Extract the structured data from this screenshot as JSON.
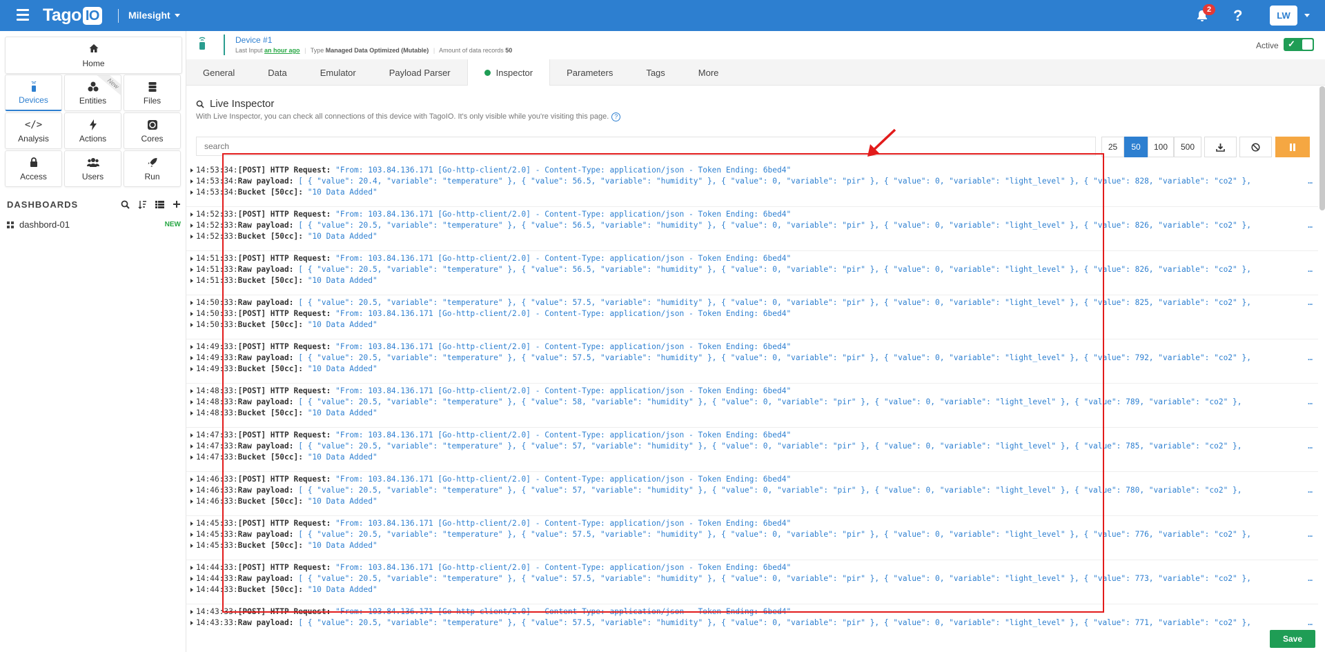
{
  "topbar": {
    "logo": "Tago",
    "logo_io": "IO",
    "account": "Milesight",
    "notifications": "2",
    "help": "?",
    "user": "LW"
  },
  "sidebar": {
    "home": "Home",
    "tiles": [
      "Devices",
      "Entities",
      "Files",
      "Analysis",
      "Actions",
      "Cores",
      "Access",
      "Users",
      "Run"
    ],
    "entities_ribbon": "New",
    "dashboards_title": "DASHBOARDS",
    "dashboards": [
      {
        "name": "dashbord-01",
        "badge": "NEW"
      }
    ]
  },
  "device": {
    "name": "Device #1",
    "last_input_label": "Last Input",
    "last_input": "an hour ago",
    "type_label": "Type",
    "type": "Managed Data Optimized (Mutable)",
    "records_label": "Amount of data records",
    "records": "50",
    "active_label": "Active"
  },
  "tabs": [
    "General",
    "Data",
    "Emulator",
    "Payload Parser",
    "Inspector",
    "Parameters",
    "Tags",
    "More"
  ],
  "inspector": {
    "title": "Live Inspector",
    "description": "With Live Inspector, you can check all connections of this device with TagoIO. It's only visible while you're visiting this page.",
    "search_placeholder": "search",
    "page_sizes": [
      "25",
      "50",
      "100",
      "500"
    ]
  },
  "log_entries": [
    [
      "14:53:34",
      "[POST] HTTP Request:",
      "\"From: 103.84.136.171 [Go-http-client/2.0] - Content-Type: application/json - Token Ending: 6bed4\""
    ],
    [
      "14:53:34",
      "Raw payload:",
      "[ { \"value\": 20.4, \"variable\": \"temperature\" }, { \"value\": 56.5, \"variable\": \"humidity\" }, { \"value\": 0, \"variable\": \"pir\" }, { \"value\": 0, \"variable\": \"light_level\" }, { \"value\": 828, \"variable\": \"co2\" },"
    ],
    [
      "14:53:34",
      "Bucket [50cc]:",
      "\"10 Data Added\""
    ],
    [
      "14:52:33",
      "[POST] HTTP Request:",
      "\"From: 103.84.136.171 [Go-http-client/2.0] - Content-Type: application/json - Token Ending: 6bed4\""
    ],
    [
      "14:52:33",
      "Raw payload:",
      "[ { \"value\": 20.5, \"variable\": \"temperature\" }, { \"value\": 56.5, \"variable\": \"humidity\" }, { \"value\": 0, \"variable\": \"pir\" }, { \"value\": 0, \"variable\": \"light_level\" }, { \"value\": 826, \"variable\": \"co2\" },"
    ],
    [
      "14:52:33",
      "Bucket [50cc]:",
      "\"10 Data Added\""
    ],
    [
      "14:51:33",
      "[POST] HTTP Request:",
      "\"From: 103.84.136.171 [Go-http-client/2.0] - Content-Type: application/json - Token Ending: 6bed4\""
    ],
    [
      "14:51:33",
      "Raw payload:",
      "[ { \"value\": 20.5, \"variable\": \"temperature\" }, { \"value\": 56.5, \"variable\": \"humidity\" }, { \"value\": 0, \"variable\": \"pir\" }, { \"value\": 0, \"variable\": \"light_level\" }, { \"value\": 826, \"variable\": \"co2\" },"
    ],
    [
      "14:51:33",
      "Bucket [50cc]:",
      "\"10 Data Added\""
    ],
    [
      "14:50:33",
      "Raw payload:",
      "[ { \"value\": 20.5, \"variable\": \"temperature\" }, { \"value\": 57.5, \"variable\": \"humidity\" }, { \"value\": 0, \"variable\": \"pir\" }, { \"value\": 0, \"variable\": \"light_level\" }, { \"value\": 825, \"variable\": \"co2\" },"
    ],
    [
      "14:50:33",
      "[POST] HTTP Request:",
      "\"From: 103.84.136.171 [Go-http-client/2.0] - Content-Type: application/json - Token Ending: 6bed4\""
    ],
    [
      "14:50:33",
      "Bucket [50cc]:",
      "\"10 Data Added\""
    ],
    [
      "14:49:33",
      "[POST] HTTP Request:",
      "\"From: 103.84.136.171 [Go-http-client/2.0] - Content-Type: application/json - Token Ending: 6bed4\""
    ],
    [
      "14:49:33",
      "Raw payload:",
      "[ { \"value\": 20.5, \"variable\": \"temperature\" }, { \"value\": 57.5, \"variable\": \"humidity\" }, { \"value\": 0, \"variable\": \"pir\" }, { \"value\": 0, \"variable\": \"light_level\" }, { \"value\": 792, \"variable\": \"co2\" },"
    ],
    [
      "14:49:33",
      "Bucket [50cc]:",
      "\"10 Data Added\""
    ],
    [
      "14:48:33",
      "[POST] HTTP Request:",
      "\"From: 103.84.136.171 [Go-http-client/2.0] - Content-Type: application/json - Token Ending: 6bed4\""
    ],
    [
      "14:48:33",
      "Raw payload:",
      "[ { \"value\": 20.5, \"variable\": \"temperature\" }, { \"value\": 58, \"variable\": \"humidity\" }, { \"value\": 0, \"variable\": \"pir\" }, { \"value\": 0, \"variable\": \"light_level\" }, { \"value\": 789, \"variable\": \"co2\" },"
    ],
    [
      "14:48:33",
      "Bucket [50cc]:",
      "\"10 Data Added\""
    ],
    [
      "14:47:33",
      "[POST] HTTP Request:",
      "\"From: 103.84.136.171 [Go-http-client/2.0] - Content-Type: application/json - Token Ending: 6bed4\""
    ],
    [
      "14:47:33",
      "Raw payload:",
      "[ { \"value\": 20.5, \"variable\": \"temperature\" }, { \"value\": 57, \"variable\": \"humidity\" }, { \"value\": 0, \"variable\": \"pir\" }, { \"value\": 0, \"variable\": \"light_level\" }, { \"value\": 785, \"variable\": \"co2\" },"
    ],
    [
      "14:47:33",
      "Bucket [50cc]:",
      "\"10 Data Added\""
    ],
    [
      "14:46:33",
      "[POST] HTTP Request:",
      "\"From: 103.84.136.171 [Go-http-client/2.0] - Content-Type: application/json - Token Ending: 6bed4\""
    ],
    [
      "14:46:33",
      "Raw payload:",
      "[ { \"value\": 20.5, \"variable\": \"temperature\" }, { \"value\": 57, \"variable\": \"humidity\" }, { \"value\": 0, \"variable\": \"pir\" }, { \"value\": 0, \"variable\": \"light_level\" }, { \"value\": 780, \"variable\": \"co2\" },"
    ],
    [
      "14:46:33",
      "Bucket [50cc]:",
      "\"10 Data Added\""
    ],
    [
      "14:45:33",
      "[POST] HTTP Request:",
      "\"From: 103.84.136.171 [Go-http-client/2.0] - Content-Type: application/json - Token Ending: 6bed4\""
    ],
    [
      "14:45:33",
      "Raw payload:",
      "[ { \"value\": 20.5, \"variable\": \"temperature\" }, { \"value\": 57.5, \"variable\": \"humidity\" }, { \"value\": 0, \"variable\": \"pir\" }, { \"value\": 0, \"variable\": \"light_level\" }, { \"value\": 776, \"variable\": \"co2\" },"
    ],
    [
      "14:45:33",
      "Bucket [50cc]:",
      "\"10 Data Added\""
    ],
    [
      "14:44:33",
      "[POST] HTTP Request:",
      "\"From: 103.84.136.171 [Go-http-client/2.0] - Content-Type: application/json - Token Ending: 6bed4\""
    ],
    [
      "14:44:33",
      "Raw payload:",
      "[ { \"value\": 20.5, \"variable\": \"temperature\" }, { \"value\": 57.5, \"variable\": \"humidity\" }, { \"value\": 0, \"variable\": \"pir\" }, { \"value\": 0, \"variable\": \"light_level\" }, { \"value\": 773, \"variable\": \"co2\" },"
    ],
    [
      "14:44:33",
      "Bucket [50cc]:",
      "\"10 Data Added\""
    ],
    [
      "14:43:33",
      "[POST] HTTP Request:",
      "\"From: 103.84.136.171 [Go-http-client/2.0] - Content-Type: application/json - Token Ending: 6bed4\""
    ],
    [
      "14:43:33",
      "Raw payload:",
      "[ { \"value\": 20.5, \"variable\": \"temperature\" }, { \"value\": 57.5, \"variable\": \"humidity\" }, { \"value\": 0, \"variable\": \"pir\" }, { \"value\": 0, \"variable\": \"light_level\" }, { \"value\": 771, \"variable\": \"co2\" },"
    ]
  ],
  "more_glyph": "…",
  "save_label": "Save",
  "colors": {
    "brand": "#2d7fd0",
    "success": "#1f9d55",
    "highlight": "#e21b1b",
    "pause": "#f5a742"
  }
}
